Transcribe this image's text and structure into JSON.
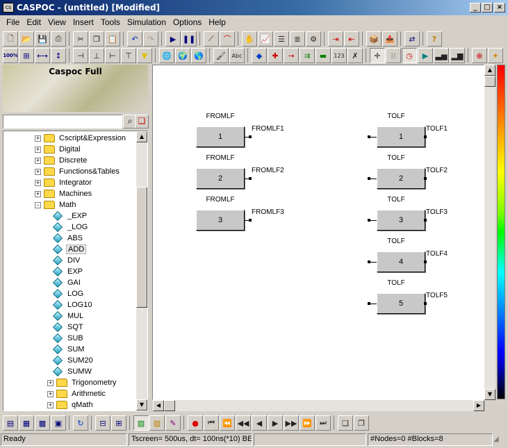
{
  "window": {
    "title": "CASPOC - (untitled) [Modified]",
    "app_icon_text": "cs",
    "minimize": "_",
    "maximize": "□",
    "close": "×"
  },
  "menu": [
    "File",
    "Edit",
    "View",
    "Insert",
    "Tools",
    "Simulation",
    "Options",
    "Help"
  ],
  "toolbar": {
    "zoom_label": "100%",
    "text_tool_label": "Abc",
    "numeric_tool_label": "123"
  },
  "library": {
    "banner_title": "Caspoc Full",
    "search_value": "",
    "tree": [
      {
        "label": "Cscript&Expression",
        "type": "folder",
        "expander": "+",
        "level": 0
      },
      {
        "label": "Digital",
        "type": "folder",
        "expander": "+",
        "level": 0
      },
      {
        "label": "Discrete",
        "type": "folder",
        "expander": "+",
        "level": 0
      },
      {
        "label": "Functions&Tables",
        "type": "folder",
        "expander": "+",
        "level": 0
      },
      {
        "label": "Integrator",
        "type": "folder",
        "expander": "+",
        "level": 0
      },
      {
        "label": "Machines",
        "type": "folder",
        "expander": "+",
        "level": 0
      },
      {
        "label": "Math",
        "type": "folder",
        "expander": "-",
        "level": 0
      },
      {
        "label": "_EXP",
        "type": "item",
        "level": 1
      },
      {
        "label": "_LOG",
        "type": "item",
        "level": 1
      },
      {
        "label": "ABS",
        "type": "item",
        "level": 1
      },
      {
        "label": "ADD",
        "type": "item",
        "level": 1,
        "selected": true
      },
      {
        "label": "DIV",
        "type": "item",
        "level": 1
      },
      {
        "label": "EXP",
        "type": "item",
        "level": 1
      },
      {
        "label": "GAI",
        "type": "item",
        "level": 1
      },
      {
        "label": "LOG",
        "type": "item",
        "level": 1
      },
      {
        "label": "LOG10",
        "type": "item",
        "level": 1
      },
      {
        "label": "MUL",
        "type": "item",
        "level": 1
      },
      {
        "label": "SQT",
        "type": "item",
        "level": 1
      },
      {
        "label": "SUB",
        "type": "item",
        "level": 1
      },
      {
        "label": "SUM",
        "type": "item",
        "level": 1
      },
      {
        "label": "SUM20",
        "type": "item",
        "level": 1
      },
      {
        "label": "SUMW",
        "type": "item",
        "level": 1
      },
      {
        "label": "Trigonometry",
        "type": "folder",
        "expander": "+",
        "level": 1
      },
      {
        "label": "Arithmetic",
        "type": "folder",
        "expander": "+",
        "level": 1
      },
      {
        "label": "qMath",
        "type": "folder",
        "expander": "+",
        "level": 1
      }
    ]
  },
  "schematic": {
    "from_blocks": [
      {
        "type": "FROMLF",
        "id": "1",
        "output": "FROMLF1"
      },
      {
        "type": "FROMLF",
        "id": "2",
        "output": "FROMLF2"
      },
      {
        "type": "FROMLF",
        "id": "3",
        "output": "FROMLF3"
      }
    ],
    "to_blocks": [
      {
        "type": "TOLF",
        "id": "1",
        "output": "TOLF1"
      },
      {
        "type": "TOLF",
        "id": "2",
        "output": "TOLF2"
      },
      {
        "type": "TOLF",
        "id": "3",
        "output": "TOLF3"
      },
      {
        "type": "TOLF",
        "id": "4",
        "output": "TOLF4"
      },
      {
        "type": "TOLF",
        "id": "5",
        "output": "TOLF5"
      }
    ]
  },
  "status": {
    "state": "Ready",
    "timing": "Tscreen= 500us, dt= 100ns(*10) BE",
    "counts": "#Nodes=0 #Blocks=8"
  },
  "colors": {
    "titlebar_start": "#0a246a",
    "titlebar_end": "#a6caf0",
    "block_fill": "#c8c8c8",
    "canvas": "#ffffff",
    "chrome": "#d4d0c8",
    "record_red": "#e00000"
  },
  "icons": {
    "top_toolbar": [
      "new-file-icon",
      "open-folder-icon",
      "save-icon",
      "print-icon",
      "cut-icon",
      "copy-icon",
      "paste-icon",
      "undo-icon",
      "redo-icon",
      "run-icon",
      "pause-icon",
      "line-tool-icon",
      "curve-tool-icon",
      "hand-pan-icon",
      "chart-icon",
      "list-icon",
      "filter-icon",
      "settings-list-icon",
      "arrow-right-icon",
      "arrow-left-icon",
      "library-add-icon",
      "library-remove-icon",
      "export-icon",
      "help-icon"
    ],
    "bottom_toolbar": [
      "window-tile-icon",
      "document-icon",
      "grid-icon",
      "component-icon",
      "refresh-icon",
      "tree-icon",
      "hierarchy-icon",
      "image-icon",
      "library-icon",
      "edit-icon",
      "record-icon",
      "first-icon",
      "rewind-icon",
      "step-back-icon",
      "back-icon",
      "play-icon",
      "forward-icon",
      "fast-forward-icon",
      "last-icon",
      "cascade-icon",
      "copy-windows-icon"
    ]
  }
}
